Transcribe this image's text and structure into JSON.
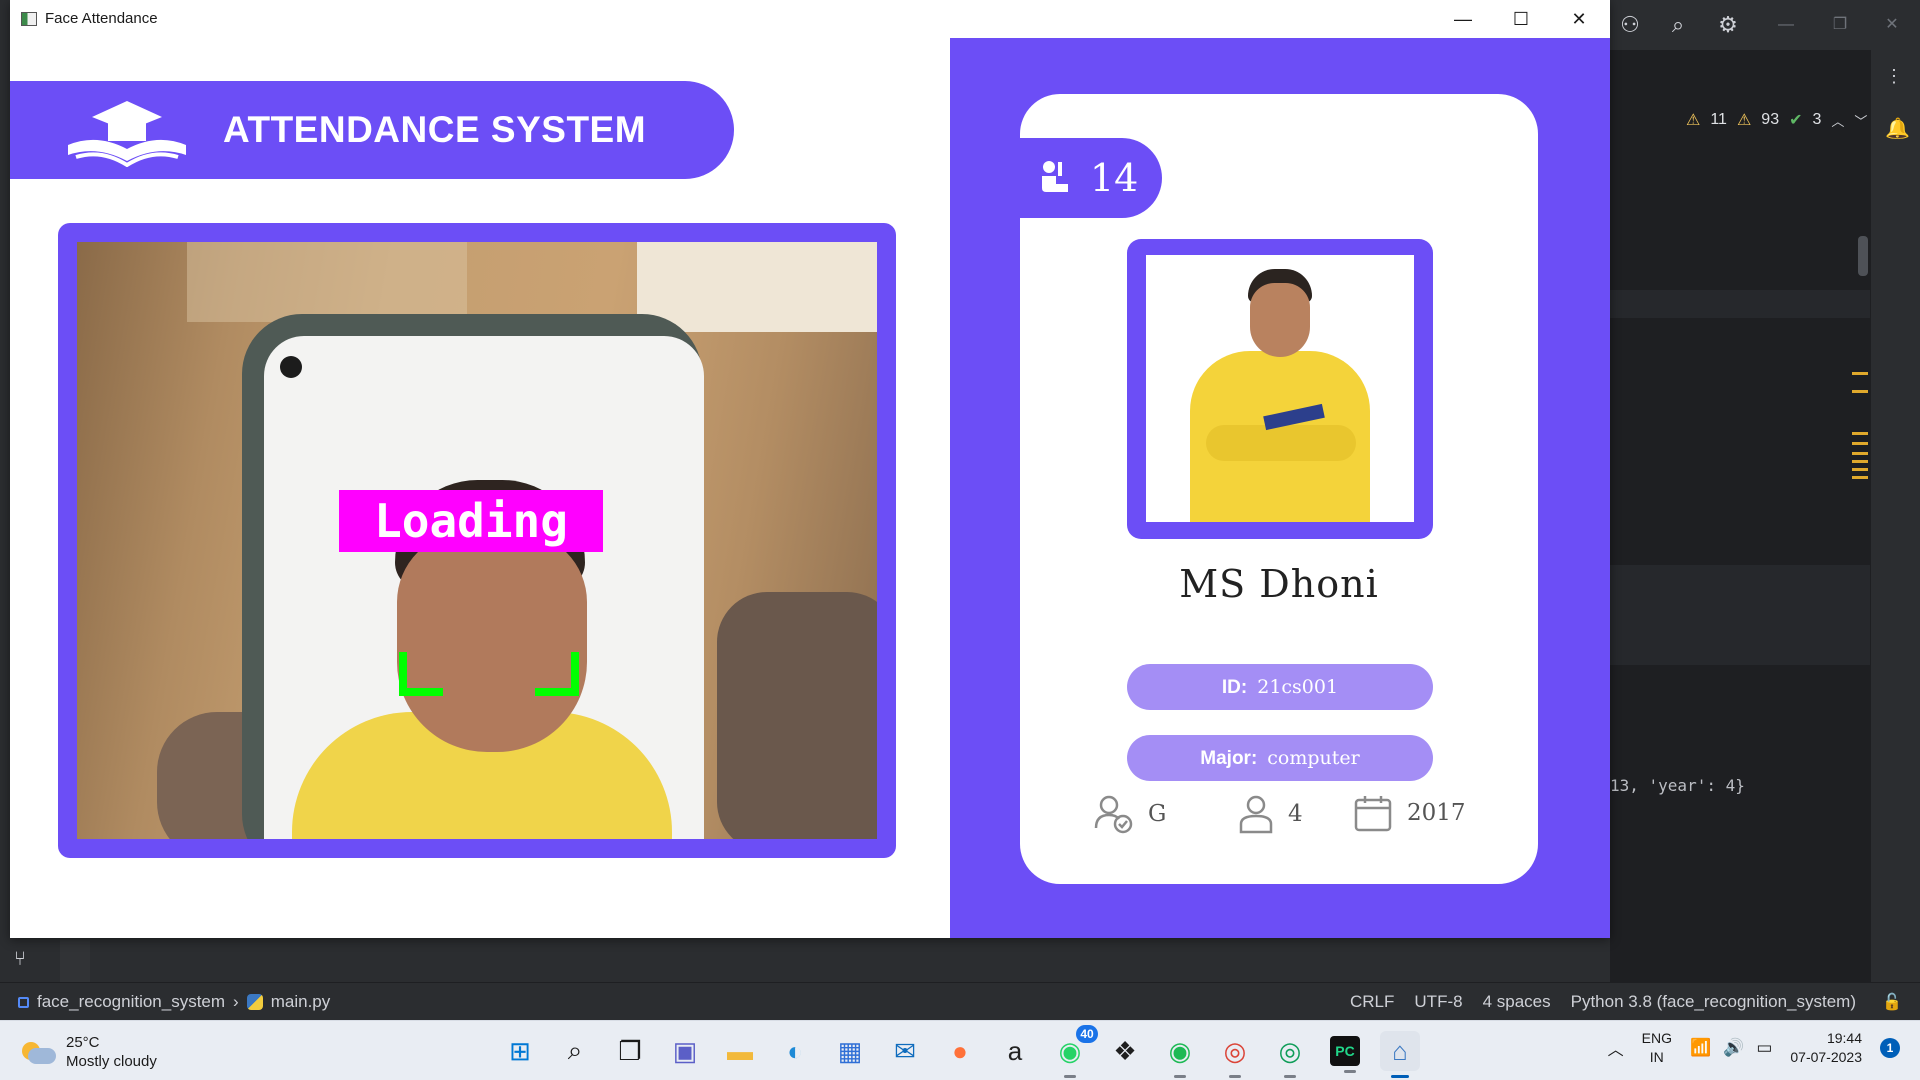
{
  "window": {
    "title": "Face Attendance",
    "minimize_glyph": "—",
    "maximize_glyph": "☐",
    "close_glyph": "✕"
  },
  "header": {
    "title": "ATTENDANCE SYSTEM",
    "logo_icon": "graduation-cap-book-icon"
  },
  "camera": {
    "overlay_text": "Loading",
    "overlay_color": "#ff00ff",
    "bracket_color": "#00ff00"
  },
  "student": {
    "total_attendance": "14",
    "name": "MS Dhoni",
    "id_label": "ID:",
    "id_value": "21cs001",
    "major_label": "Major:",
    "major_value": "computer",
    "standing": "G",
    "year": "4",
    "starting_year": "2017"
  },
  "colors": {
    "accent": "#6c4ef6",
    "pill": "#a48ef5"
  },
  "ide": {
    "inspections": {
      "warnings_major": "11",
      "warnings_minor": "93",
      "ok": "3"
    },
    "code_fragment": "13, 'year': 4}",
    "statusbar": {
      "project": "face_recognition_system",
      "file": "main.py",
      "line_sep": "CRLF",
      "encoding": "UTF-8",
      "indent": "4 spaces",
      "interpreter": "Python 3.8 (face_recognition_system)"
    }
  },
  "taskbar": {
    "weather_temp": "25°C",
    "weather_desc": "Mostly cloudy",
    "whatsapp_badge": "40",
    "lang_top": "ENG",
    "lang_bottom": "IN",
    "time": "19:44",
    "date": "07-07-2023",
    "notification_count": "1"
  }
}
